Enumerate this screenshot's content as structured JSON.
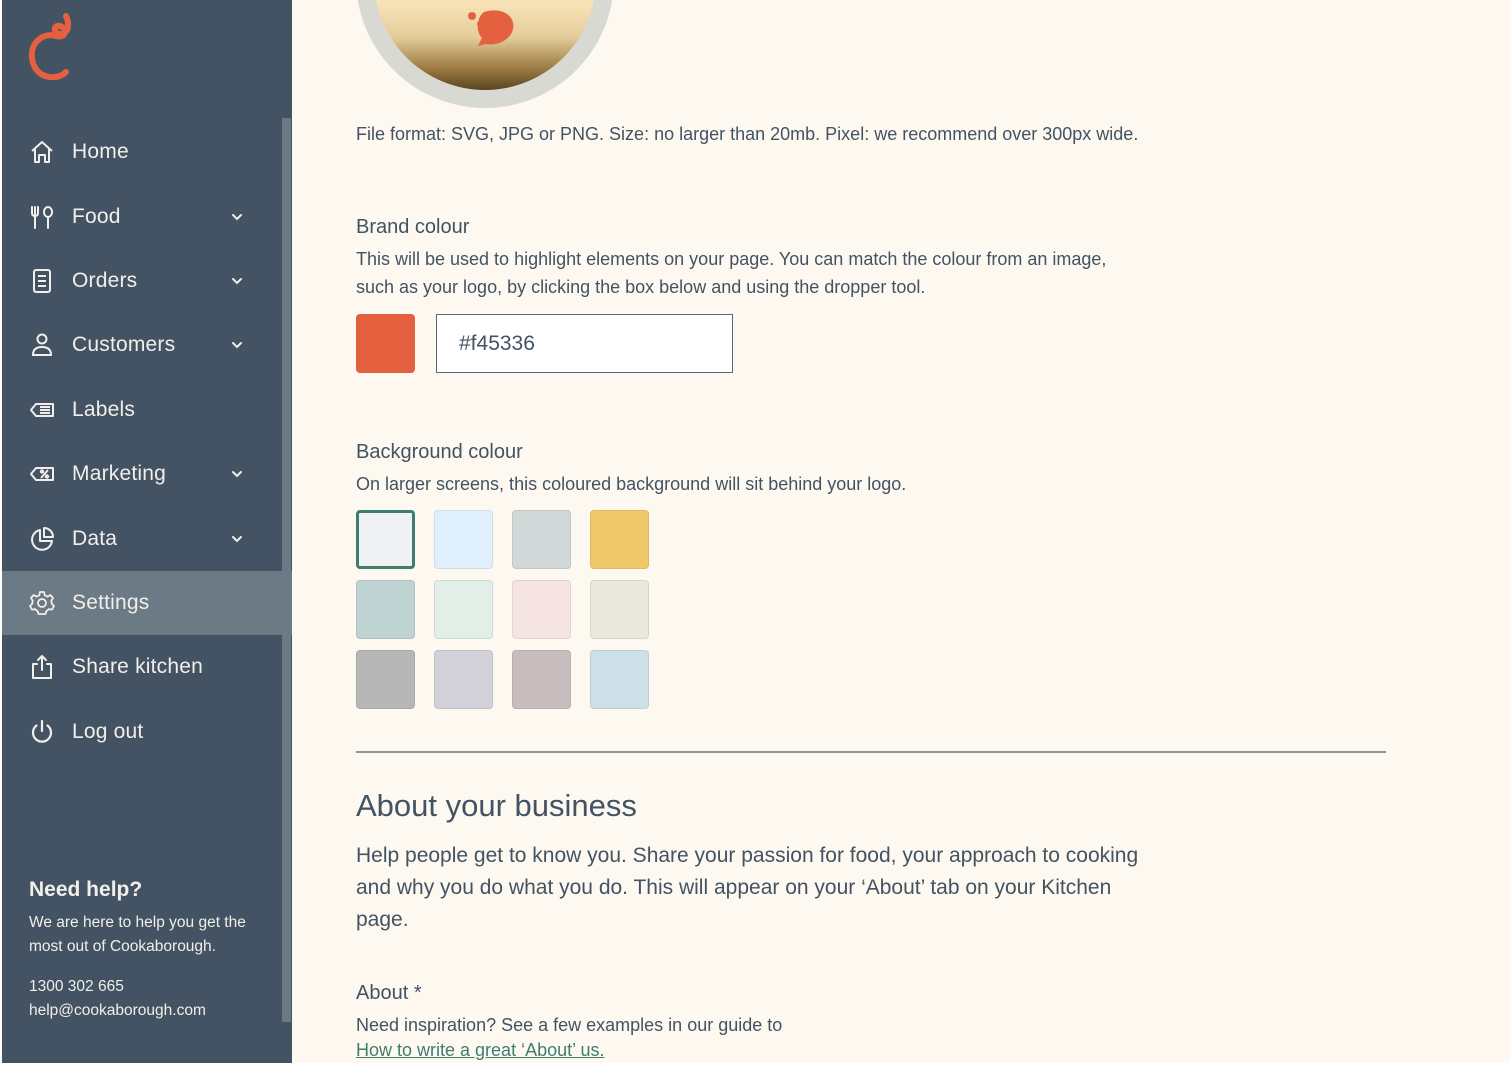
{
  "sidebar": {
    "logo_icon": "cookaborough-swirl-logo",
    "items": [
      {
        "label": "Home",
        "icon": "home-icon",
        "has_dropdown": false,
        "active": false
      },
      {
        "label": "Food",
        "icon": "utensils-icon",
        "has_dropdown": true,
        "active": false
      },
      {
        "label": "Orders",
        "icon": "receipt-icon",
        "has_dropdown": true,
        "active": false
      },
      {
        "label": "Customers",
        "icon": "user-icon",
        "has_dropdown": true,
        "active": false
      },
      {
        "label": "Labels",
        "icon": "label-tag-icon",
        "has_dropdown": false,
        "active": false
      },
      {
        "label": "Marketing",
        "icon": "discount-tag-icon",
        "has_dropdown": true,
        "active": false
      },
      {
        "label": "Data",
        "icon": "pie-chart-icon",
        "has_dropdown": true,
        "active": false
      },
      {
        "label": "Settings",
        "icon": "gear-icon",
        "has_dropdown": false,
        "active": true
      },
      {
        "label": "Share kitchen",
        "icon": "share-icon",
        "has_dropdown": false,
        "active": false
      },
      {
        "label": "Log out",
        "icon": "power-icon",
        "has_dropdown": false,
        "active": false
      }
    ],
    "help": {
      "title": "Need help?",
      "text": "We are here to help you get the most out of Cookaborough.",
      "phone": "1300 302 665",
      "email": "help@cookaborough.com"
    }
  },
  "main": {
    "logo_upload": {
      "hint": "File format: SVG, JPG or PNG. Size: no larger than 20mb. Pixel: we recommend over 300px wide."
    },
    "brand_colour": {
      "label": "Brand colour",
      "description": "This will be used to highlight elements on your page. You can match the colour from an image, such as your logo, by clicking the box below and using the dropper tool.",
      "value": "#f45336",
      "swatch_color": "#e4603f"
    },
    "background_colour": {
      "label": "Background colour",
      "description": "On larger screens, this coloured background will sit behind your logo.",
      "selected_index": 0,
      "options": [
        "#f0f1f2",
        "#e0f0fc",
        "#d2d8d8",
        "#f0c96a",
        "#bed3d2",
        "#e2eee8",
        "#f6e4e2",
        "#ebe8dd",
        "#b7b7b7",
        "#d2d1da",
        "#c7bdbc",
        "#cde0e7"
      ]
    },
    "about_business": {
      "title": "About your business",
      "description": "Help people get to know you. Share your passion for food, your approach to cooking and why you do what you do. This will appear on your ‘About’ tab on your Kitchen page.",
      "field_label": "About *",
      "field_hint": "Need inspiration? See a few examples in our guide to",
      "guide_link": "How to write a great ‘About’ us."
    }
  },
  "colors": {
    "sidebar_bg": "#435363",
    "sidebar_active": "#6c7a86",
    "page_bg": "#fdf9f0",
    "text": "#435363",
    "accent": "#3f7d70",
    "brand": "#e4603f"
  }
}
